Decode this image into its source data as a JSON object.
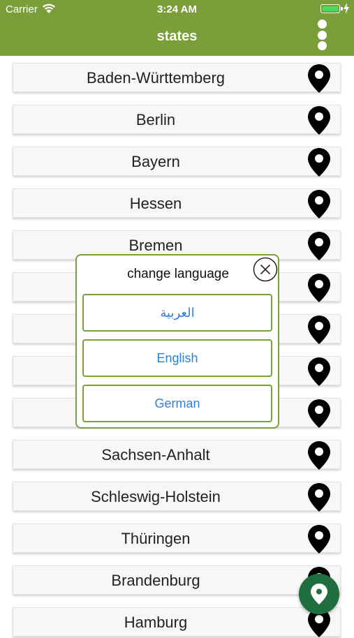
{
  "status_bar": {
    "carrier": "Carrier",
    "time": "3:24 AM",
    "icons": [
      "wifi-icon",
      "battery-icon",
      "charging-bolt-icon"
    ]
  },
  "nav": {
    "title": "states",
    "menu_icon": "vertical-ellipsis-icon"
  },
  "states": [
    {
      "name": "Baden-Württemberg",
      "icon": "map-pin-icon"
    },
    {
      "name": "Berlin",
      "icon": "map-pin-icon"
    },
    {
      "name": "Bayern",
      "icon": "map-pin-icon"
    },
    {
      "name": "Hessen",
      "icon": "map-pin-icon"
    },
    {
      "name": "Bremen",
      "icon": "map-pin-icon"
    },
    {
      "name": "",
      "icon": "map-pin-icon"
    },
    {
      "name": "",
      "icon": "map-pin-icon"
    },
    {
      "name": "",
      "icon": "map-pin-icon"
    },
    {
      "name": "",
      "icon": "map-pin-icon"
    },
    {
      "name": "Sachsen-Anhalt",
      "icon": "map-pin-icon"
    },
    {
      "name": "Schleswig-Holstein",
      "icon": "map-pin-icon"
    },
    {
      "name": "Thüringen",
      "icon": "map-pin-icon"
    },
    {
      "name": "Brandenburg",
      "icon": "map-pin-icon"
    },
    {
      "name": "Hamburg",
      "icon": "map-pin-icon"
    }
  ],
  "fab": {
    "icon": "map-pin-icon"
  },
  "dialog": {
    "title": "change language",
    "close_icon": "close-circle-icon",
    "options": [
      "العربية",
      "English",
      "German"
    ]
  },
  "colors": {
    "header": "#7a9e3a",
    "dialog_border": "#7a9e3a",
    "option_text": "#2f7fd8",
    "fab": "#1e6e3e"
  }
}
